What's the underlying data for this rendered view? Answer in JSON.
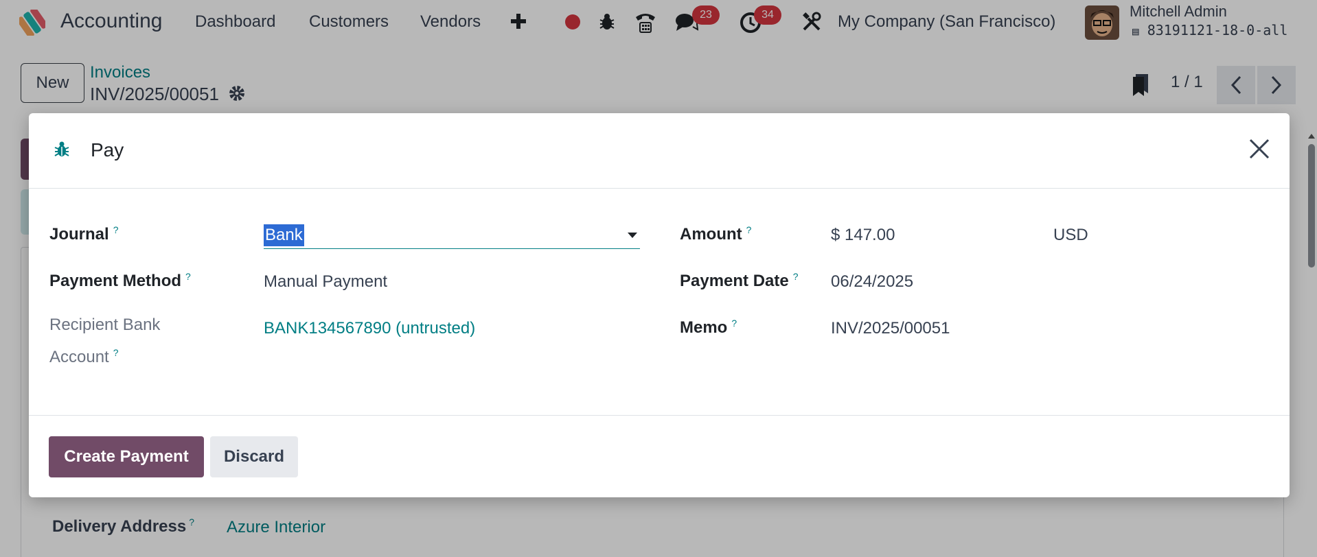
{
  "navbar": {
    "app_name": "Accounting",
    "menu": [
      "Dashboard",
      "Customers",
      "Vendors"
    ],
    "add_icon": "plus-icon",
    "messages_count": "23",
    "activities_count": "34",
    "company": "My Company (San Francisco)",
    "user_name": "Mitchell Admin",
    "database": "83191121-18-0-all"
  },
  "control_panel": {
    "new_label": "New",
    "breadcrumb_parent": "Invoices",
    "breadcrumb_current": "INV/2025/00051",
    "pager_value": "1 / 1"
  },
  "background_form": {
    "delivery_address_label": "Delivery Address",
    "delivery_address_value": "Azure Interior"
  },
  "dialog": {
    "title": "Pay",
    "fields": {
      "journal_label": "Journal",
      "journal_value": "Bank",
      "payment_method_label": "Payment Method",
      "payment_method_value": "Manual Payment",
      "recipient_bank_label_line1": "Recipient Bank",
      "recipient_bank_label_line2": "Account",
      "recipient_bank_value": "BANK134567890 (untrusted)",
      "amount_label": "Amount",
      "amount_value": "$ 147.00",
      "currency_value": "USD",
      "payment_date_label": "Payment Date",
      "payment_date_value": "06/24/2025",
      "memo_label": "Memo",
      "memo_value": "INV/2025/00051"
    },
    "tooltip_marker": "?",
    "buttons": {
      "create_payment": "Create Payment",
      "discard": "Discard"
    }
  },
  "colors": {
    "brand": "#714b67",
    "link": "#017e84",
    "badge": "#d4353f",
    "selection": "#2d6bd4"
  }
}
